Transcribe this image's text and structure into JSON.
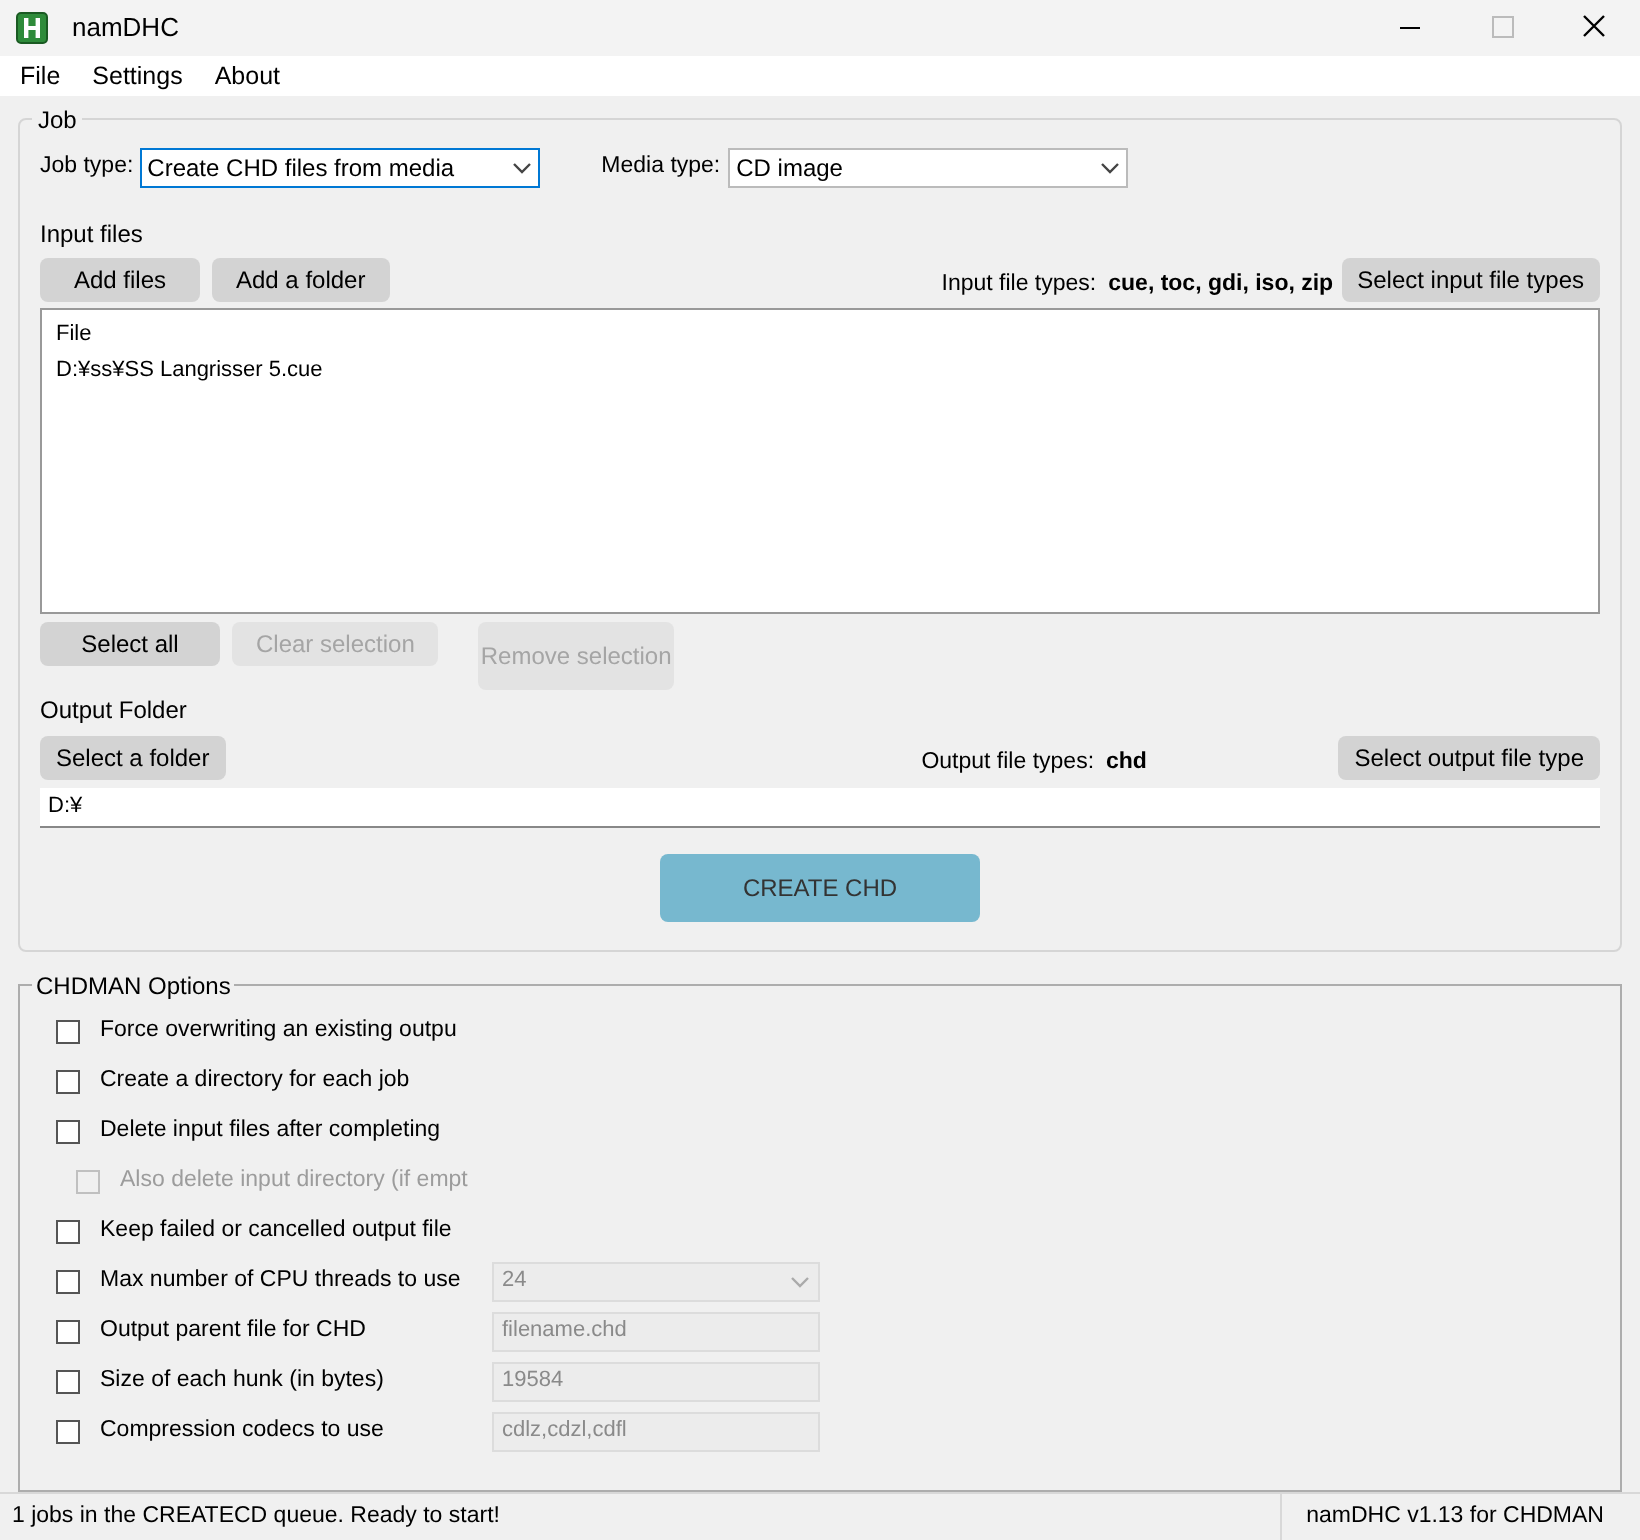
{
  "window": {
    "title": "namDHC"
  },
  "menu": [
    "File",
    "Settings",
    "About"
  ],
  "job": {
    "title": "Job",
    "job_type": {
      "label": "Job type:",
      "value": "Create CHD files from media"
    },
    "media_type": {
      "label": "Media type:",
      "value": "CD image"
    },
    "input_files": {
      "title": "Input files",
      "buttons": [
        {
          "label": "Add files",
          "disabled": false
        },
        {
          "label": "Add a folder",
          "disabled": false
        }
      ],
      "types_label": "Input file types:",
      "types": "cue, toc, gdi, iso, zip",
      "types_button": "Select input file types",
      "list_header": "File",
      "items": [
        "D:¥ss¥SS Langrisser 5.cue"
      ],
      "actions": [
        {
          "label": "Select all",
          "disabled": false
        },
        {
          "label": "Clear selection",
          "disabled": true
        },
        {
          "label": "Remove selection",
          "disabled": true
        }
      ]
    },
    "output": {
      "title": "Output Folder",
      "folder_button": "Select a folder",
      "types_label": "Output file types:",
      "types": "chd",
      "types_button": "Select output file type",
      "path": "D:¥"
    },
    "create_button": "CREATE CHD"
  },
  "options": {
    "title": "CHDMAN Options",
    "items": [
      {
        "kind": "check",
        "label": "Force overwriting an existing outpu",
        "checked": false,
        "disabled": false
      },
      {
        "kind": "check",
        "label": "Create a directory for each job",
        "checked": false,
        "disabled": false
      },
      {
        "kind": "check",
        "label": "Delete input files after completing",
        "checked": false,
        "disabled": false,
        "children": [
          {
            "kind": "check",
            "label": "Also delete input directory (if empt",
            "checked": false,
            "disabled": true
          }
        ]
      },
      {
        "kind": "check",
        "label": "Keep failed or cancelled output file",
        "checked": false,
        "disabled": false
      },
      {
        "kind": "select",
        "label": "Max number of CPU threads to use",
        "checked": false,
        "disabled": false,
        "value": "24",
        "field_disabled": true
      },
      {
        "kind": "text",
        "label": "Output parent file for CHD",
        "checked": false,
        "disabled": false,
        "value": "filename.chd",
        "field_disabled": true
      },
      {
        "kind": "text",
        "label": "Size of each hunk (in bytes)",
        "checked": false,
        "disabled": false,
        "value": "19584",
        "field_disabled": true
      },
      {
        "kind": "text",
        "label": "Compression codecs to use",
        "checked": false,
        "disabled": false,
        "value": "cdlz,cdzl,cdfl",
        "field_disabled": true
      }
    ]
  },
  "status_bar": {
    "message": "1 jobs in the CREATECD queue. Ready to start!",
    "version": "namDHC v1.13 for CHDMAN"
  }
}
